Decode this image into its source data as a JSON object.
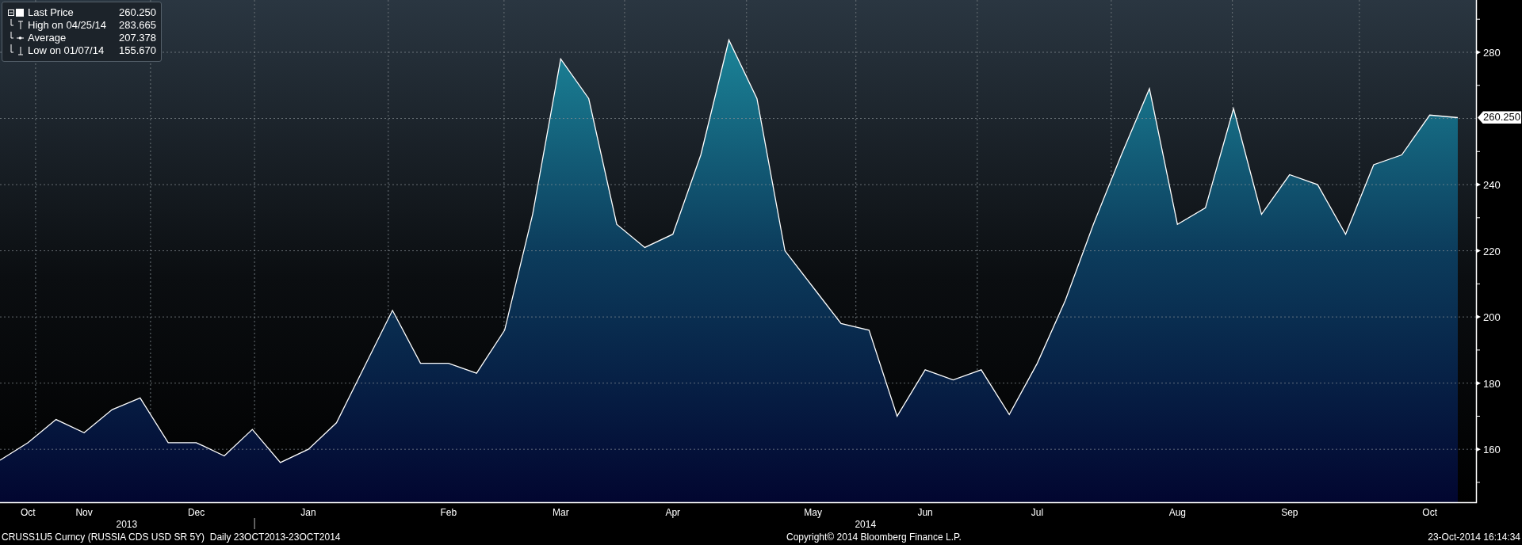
{
  "legend": [
    {
      "kind": "last",
      "value": "260.250"
    },
    {
      "kind": "high",
      "label": "High on 04/25/14",
      "value": "283.665"
    },
    {
      "kind": "average",
      "label": "Average",
      "value": "207.378"
    },
    {
      "kind": "low",
      "label": "Low on 01/07/14",
      "value": "155.670"
    }
  ],
  "chart": {
    "chart_data": {
      "type": "area",
      "grid": true,
      "ylim": [
        144,
        295.8
      ],
      "categories": [
        null,
        "Oct",
        null,
        "Nov",
        null,
        null,
        null,
        "Dec",
        null,
        null,
        null,
        "Jan",
        null,
        null,
        null,
        null,
        "Feb",
        null,
        null,
        null,
        "Mar",
        null,
        null,
        null,
        "Apr",
        null,
        null,
        null,
        null,
        "May",
        null,
        null,
        null,
        "Jun",
        null,
        null,
        null,
        "Jul",
        null,
        null,
        null,
        null,
        "Aug",
        null,
        null,
        null,
        "Sep",
        null,
        null,
        null,
        null,
        "Oct",
        null
      ],
      "series": [
        {
          "name": "Last Price",
          "color": "#ffffff",
          "values": [
            156.7,
            162,
            169,
            165,
            172,
            175.5,
            162,
            162,
            158,
            166,
            156,
            160,
            168,
            185,
            202,
            186,
            186,
            183,
            196,
            231,
            278,
            266,
            228,
            221,
            225,
            249,
            283.7,
            266,
            220,
            209,
            198,
            196,
            170,
            184,
            181,
            184,
            170.5,
            186,
            205,
            228,
            249,
            269,
            228,
            233,
            263,
            231,
            243,
            240,
            225,
            246,
            249,
            261,
            260.25
          ]
        }
      ],
      "yticks": [
        160,
        180,
        200,
        220,
        240,
        280
      ],
      "annotations": [
        "260.250"
      ]
    },
    "years": [
      "2013",
      "2014"
    ]
  },
  "footer": {
    "security": "CRUSS1U5 Curncy (RUSSIA CDS USD SR 5Y)  Daily 23OCT2013-23OCT2014",
    "copyright": "Copyright© 2014 Bloomberg Finance L.P.",
    "timestamp": "23-Oct-2014 16:14:34"
  }
}
